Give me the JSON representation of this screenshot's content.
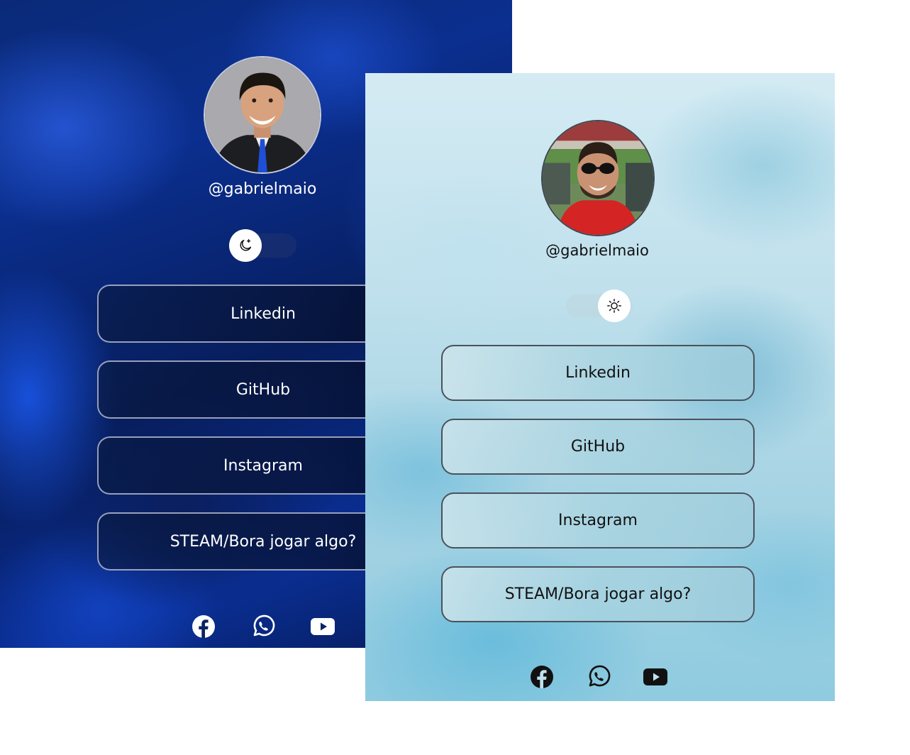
{
  "dark_card": {
    "username": "@gabrielmaio",
    "theme_toggle": {
      "mode": "dark",
      "icon": "moon-icon"
    },
    "links": [
      "Linkedin",
      "GitHub",
      "Instagram",
      "STEAM/Bora jogar algo?"
    ],
    "social": [
      "facebook-icon",
      "whatsapp-icon",
      "youtube-icon"
    ],
    "colors": {
      "background": "#0a2a78",
      "text": "#ffffff",
      "button_border": "#c8cde1"
    }
  },
  "light_card": {
    "username": "@gabrielmaio",
    "theme_toggle": {
      "mode": "light",
      "icon": "sun-icon"
    },
    "links": [
      "Linkedin",
      "GitHub",
      "Instagram",
      "STEAM/Bora jogar algo?"
    ],
    "social": [
      "facebook-icon",
      "whatsapp-icon",
      "youtube-icon"
    ],
    "colors": {
      "background": "#bfe0ec",
      "text": "#111111",
      "button_border": "#4a525c"
    }
  }
}
